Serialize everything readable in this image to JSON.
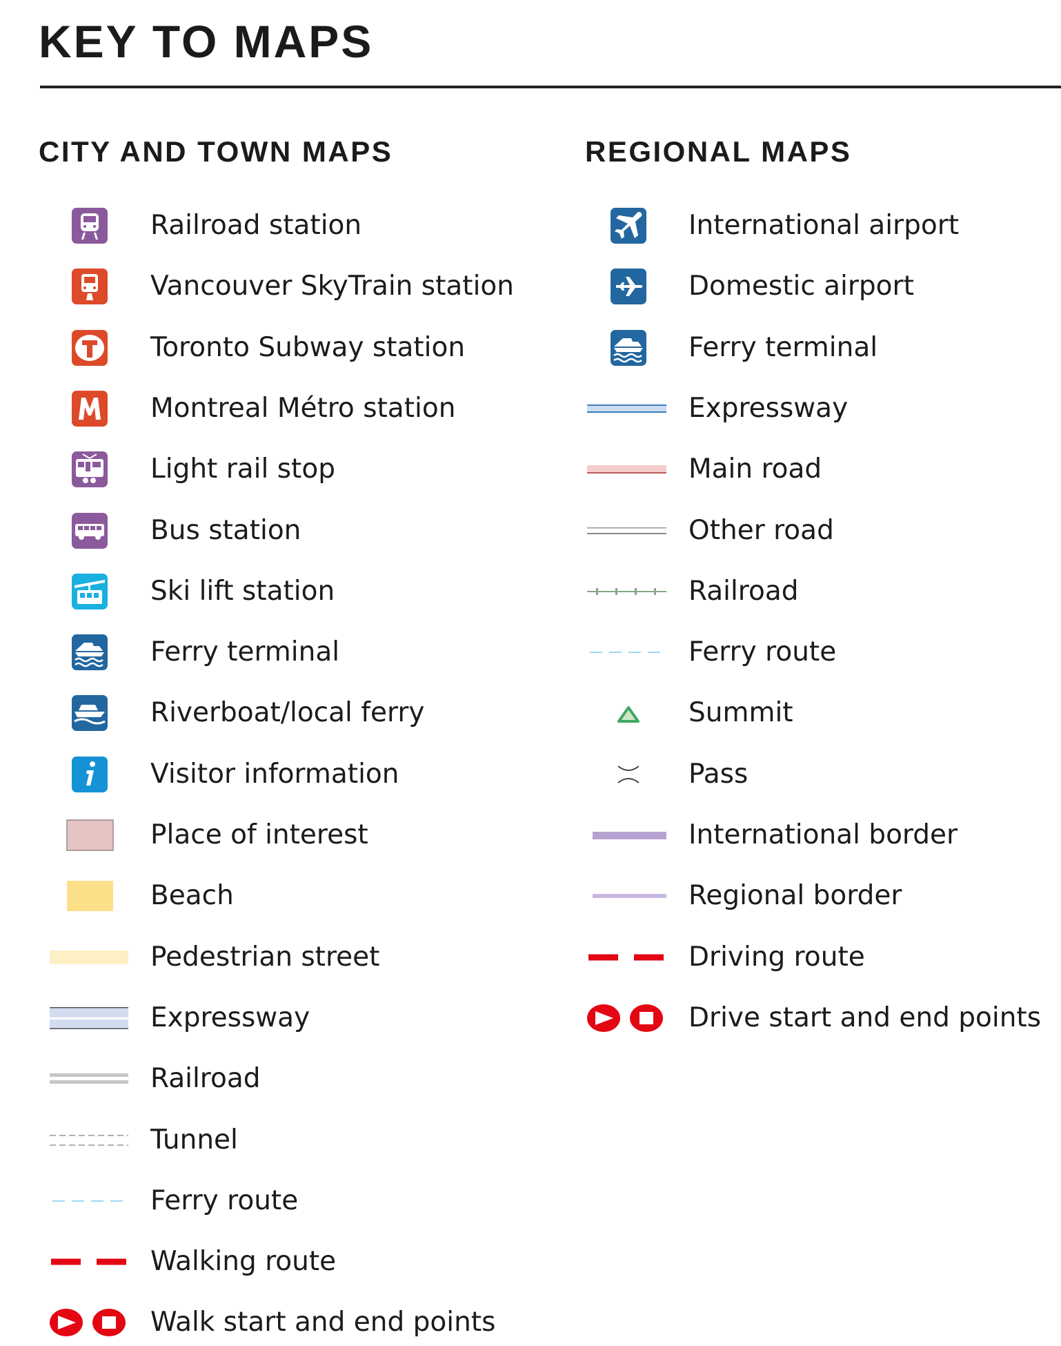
{
  "title": "KEY TO MAPS",
  "city": {
    "heading": "CITY AND TOWN MAPS",
    "items": [
      {
        "label": "Railroad station",
        "icon": "train-icon"
      },
      {
        "label": "Vancouver SkyTrain station",
        "icon": "skytrain-icon"
      },
      {
        "label": "Toronto Subway station",
        "icon": "toronto-subway-icon"
      },
      {
        "label": "Montreal Métro station",
        "icon": "montreal-metro-icon"
      },
      {
        "label": "Light rail stop",
        "icon": "light-rail-icon"
      },
      {
        "label": "Bus station",
        "icon": "bus-icon"
      },
      {
        "label": "Ski lift station",
        "icon": "ski-lift-icon"
      },
      {
        "label": "Ferry terminal",
        "icon": "ferry-icon"
      },
      {
        "label": "Riverboat/local ferry",
        "icon": "riverboat-icon"
      },
      {
        "label": "Visitor information",
        "icon": "info-icon"
      },
      {
        "label": "Place of interest",
        "icon": "place-of-interest-swatch"
      },
      {
        "label": "Beach",
        "icon": "beach-swatch"
      },
      {
        "label": "Pedestrian street",
        "icon": "pedestrian-street-line"
      },
      {
        "label": "Expressway",
        "icon": "city-expressway-line"
      },
      {
        "label": "Railroad",
        "icon": "city-railroad-line"
      },
      {
        "label": "Tunnel",
        "icon": "tunnel-line"
      },
      {
        "label": "Ferry route",
        "icon": "ferry-route-line"
      },
      {
        "label": "Walking route",
        "icon": "walking-route-line"
      },
      {
        "label": "Walk start and end points",
        "icon": "start-end-points-icon"
      }
    ]
  },
  "regional": {
    "heading": "REGIONAL MAPS",
    "items": [
      {
        "label": "International airport",
        "icon": "international-airport-icon"
      },
      {
        "label": "Domestic airport",
        "icon": "domestic-airport-icon"
      },
      {
        "label": "Ferry terminal",
        "icon": "ferry-icon"
      },
      {
        "label": "Expressway",
        "icon": "expressway-line"
      },
      {
        "label": "Main road",
        "icon": "main-road-line"
      },
      {
        "label": "Other road",
        "icon": "other-road-line"
      },
      {
        "label": "Railroad",
        "icon": "railroad-line"
      },
      {
        "label": "Ferry route",
        "icon": "ferry-route-line"
      },
      {
        "label": "Summit",
        "icon": "summit-icon"
      },
      {
        "label": "Pass",
        "icon": "pass-icon"
      },
      {
        "label": "International border",
        "icon": "international-border-line"
      },
      {
        "label": "Regional border",
        "icon": "regional-border-line"
      },
      {
        "label": "Driving route",
        "icon": "driving-route-line"
      },
      {
        "label": "Drive start and end points",
        "icon": "start-end-points-icon"
      }
    ]
  },
  "colors": {
    "transit_purple": "#8b5a9c",
    "transit_orange": "#dd4a2a",
    "ski_cyan": "#1ab0e0",
    "ferry_blue": "#22679f",
    "info_blue": "#1592d6",
    "route_red": "#e30613"
  }
}
